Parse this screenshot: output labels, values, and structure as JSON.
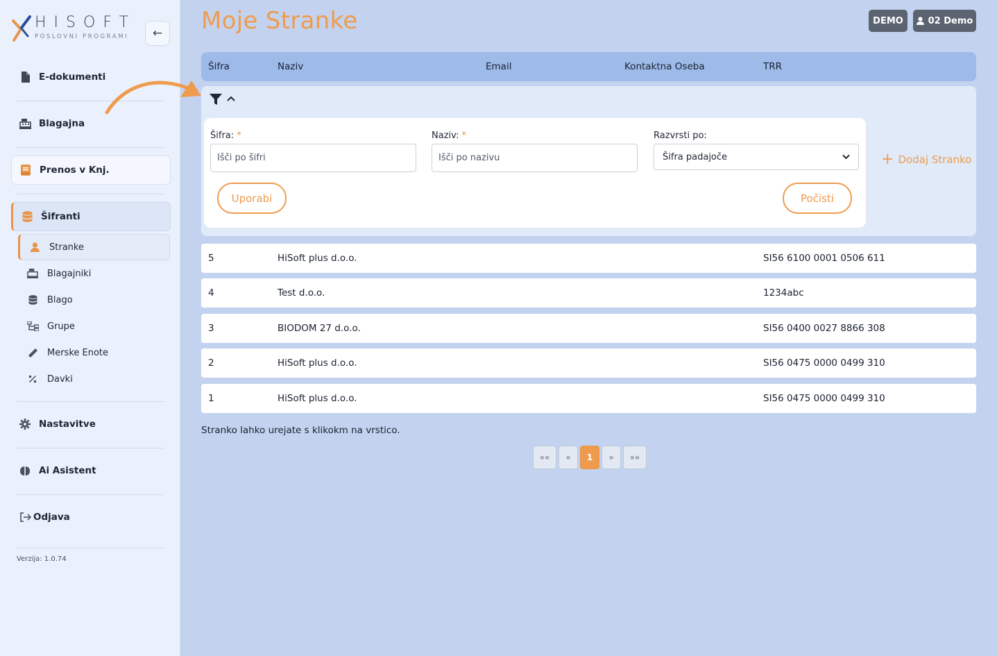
{
  "brand": {
    "logo_text": "HISOFT",
    "logo_sub": "POSLOVNI PROGRAMI"
  },
  "sidebar": {
    "items": [
      {
        "label": "E-dokumenti",
        "icon": "file-icon"
      },
      {
        "label": "Blagajna",
        "icon": "cash-register-icon"
      },
      {
        "label": "Prenos v Knj.",
        "icon": "book-icon"
      },
      {
        "label": "Šifranti",
        "icon": "database-icon"
      },
      {
        "label": "Nastavitve",
        "icon": "gear-icon"
      },
      {
        "label": "Ai Asistent",
        "icon": "brain-icon"
      },
      {
        "label": "Odjava",
        "icon": "logout-icon"
      }
    ],
    "subitems": [
      {
        "label": "Stranke",
        "icon": "user-icon"
      },
      {
        "label": "Blagajniki",
        "icon": "cash-register-icon"
      },
      {
        "label": "Blago",
        "icon": "database-icon"
      },
      {
        "label": "Grupe",
        "icon": "sitemap-icon"
      },
      {
        "label": "Merske Enote",
        "icon": "ruler-icon"
      },
      {
        "label": "Davki",
        "icon": "percent-icon"
      }
    ],
    "version": "Verzija: 1.0.74"
  },
  "header": {
    "title": "Moje Stranke",
    "badge_demo": "DEMO",
    "badge_user": "02 Demo"
  },
  "table": {
    "columns": [
      "Šifra",
      "Naziv",
      "Email",
      "Kontaktna Oseba",
      "TRR"
    ],
    "rows": [
      {
        "sifra": "5",
        "naziv": "HiSoft plus d.o.o.",
        "email": "",
        "oseba": "",
        "trr": "SI56 6100 0001 0506 611"
      },
      {
        "sifra": "4",
        "naziv": "Test d.o.o.",
        "email": "",
        "oseba": "",
        "trr": "1234abc"
      },
      {
        "sifra": "3",
        "naziv": "BIODOM 27 d.o.o.",
        "email": "",
        "oseba": "",
        "trr": "SI56 0400 0027 8866 308"
      },
      {
        "sifra": "2",
        "naziv": "HiSoft plus d.o.o.",
        "email": "",
        "oseba": "",
        "trr": "SI56 0475 0000 0499 310"
      },
      {
        "sifra": "1",
        "naziv": "HiSoft plus d.o.o.",
        "email": "",
        "oseba": "",
        "trr": "SI56 0475 0000 0499 310"
      }
    ]
  },
  "filter": {
    "sifra_label": "Šifra:",
    "sifra_placeholder": "Išči po šifri",
    "naziv_label": "Naziv:",
    "naziv_placeholder": "Išči po nazivu",
    "required_mark": "*",
    "sort_label": "Razvrsti po:",
    "sort_value": "Šifra padajoče",
    "apply_label": "Uporabi",
    "clear_label": "Počisti",
    "add_label": "Dodaj Stranko"
  },
  "hint": "Stranko lahko urejate s klikokm na vrstico.",
  "pagination": {
    "first": "««",
    "prev": "«",
    "current": "1",
    "next": "»",
    "last": "»»"
  },
  "colors": {
    "accent": "#ef9b4e",
    "header_bg": "#9dbae9",
    "page_bg": "#c3d3ef"
  }
}
